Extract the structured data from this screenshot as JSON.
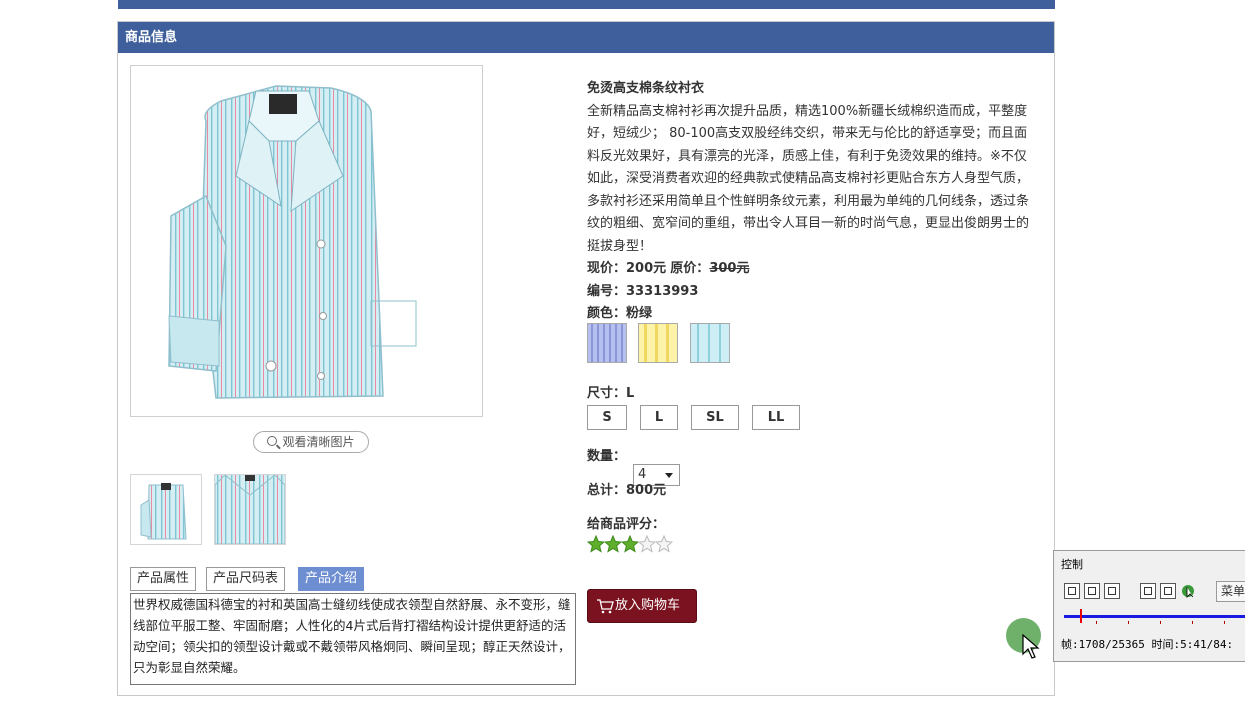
{
  "panel": {
    "title": "商品信息"
  },
  "gallery": {
    "zoom_label": "观看清晰图片",
    "thumbnails": [
      "shirt-folded-thumbnail",
      "shirt-fabric-thumbnail"
    ]
  },
  "tabs": [
    {
      "label": "产品属性",
      "active": false
    },
    {
      "label": "产品尺码表",
      "active": false
    },
    {
      "label": "产品介绍",
      "active": true
    }
  ],
  "tab_content": "世界权威德国科德宝的衬和英国高士缝纫线使成衣领型自然舒展、永不变形，缝线部位平服工整、牢固耐磨；人性化的4片式后背打褶结构设计提供更舒适的活动空间；领尖扣的领型设计戴或不戴领带风格炯同、瞬间呈现；醇正天然设计，只为彰显自然荣耀。",
  "product": {
    "name": "免烫高支棉条纹衬衣",
    "description": "全新精品高支棉衬衫再次提升品质，精选100%新疆长绒棉织造而成，平整度好，短绒少； 80-100高支双股经纬交织，带来无与伦比的舒适享受；而且面料反光效果好，具有漂亮的光泽，质感上佳，有利于免烫效果的维持。※不仅如此，深受消费者欢迎的经典款式使精品高支棉衬衫更贴合东方人身型气质，多款衬衫还采用简单且个性鲜明条纹元素，利用最为单纯的几何线条，透过条纹的粗细、宽窄间的重组，带出令人耳目一新的时尚气息，更显出俊朗男士的挺拔身型！",
    "price_label": "现价：",
    "price": "200元",
    "orig_price_label": "原价：",
    "orig_price": "300元",
    "sku_label": "编号：",
    "sku": "33313993",
    "color_label": "颜色：",
    "color": "粉绿",
    "swatches": [
      "#a9b4e6",
      "#fbee96",
      "#b8e4ee"
    ],
    "size_label": "尺寸：",
    "size": "L",
    "sizes": [
      "S",
      "L",
      "SL",
      "LL"
    ],
    "qty_label": "数量：",
    "qty": "4",
    "total_label": "总计：",
    "total": "800元",
    "rating_label": "给商品评分：",
    "rating": 3,
    "rating_max": 5,
    "cart_label": "放入购物车"
  },
  "controller": {
    "title": "控制",
    "menu_label": "菜单",
    "status": "帧:1708/25365 时间:5:41/84:"
  },
  "colors": {
    "brand_blue": "#3e5f9c",
    "tab_active": "#6e8ed2",
    "cart_button": "#7a1220",
    "star": "#5fae2c"
  }
}
